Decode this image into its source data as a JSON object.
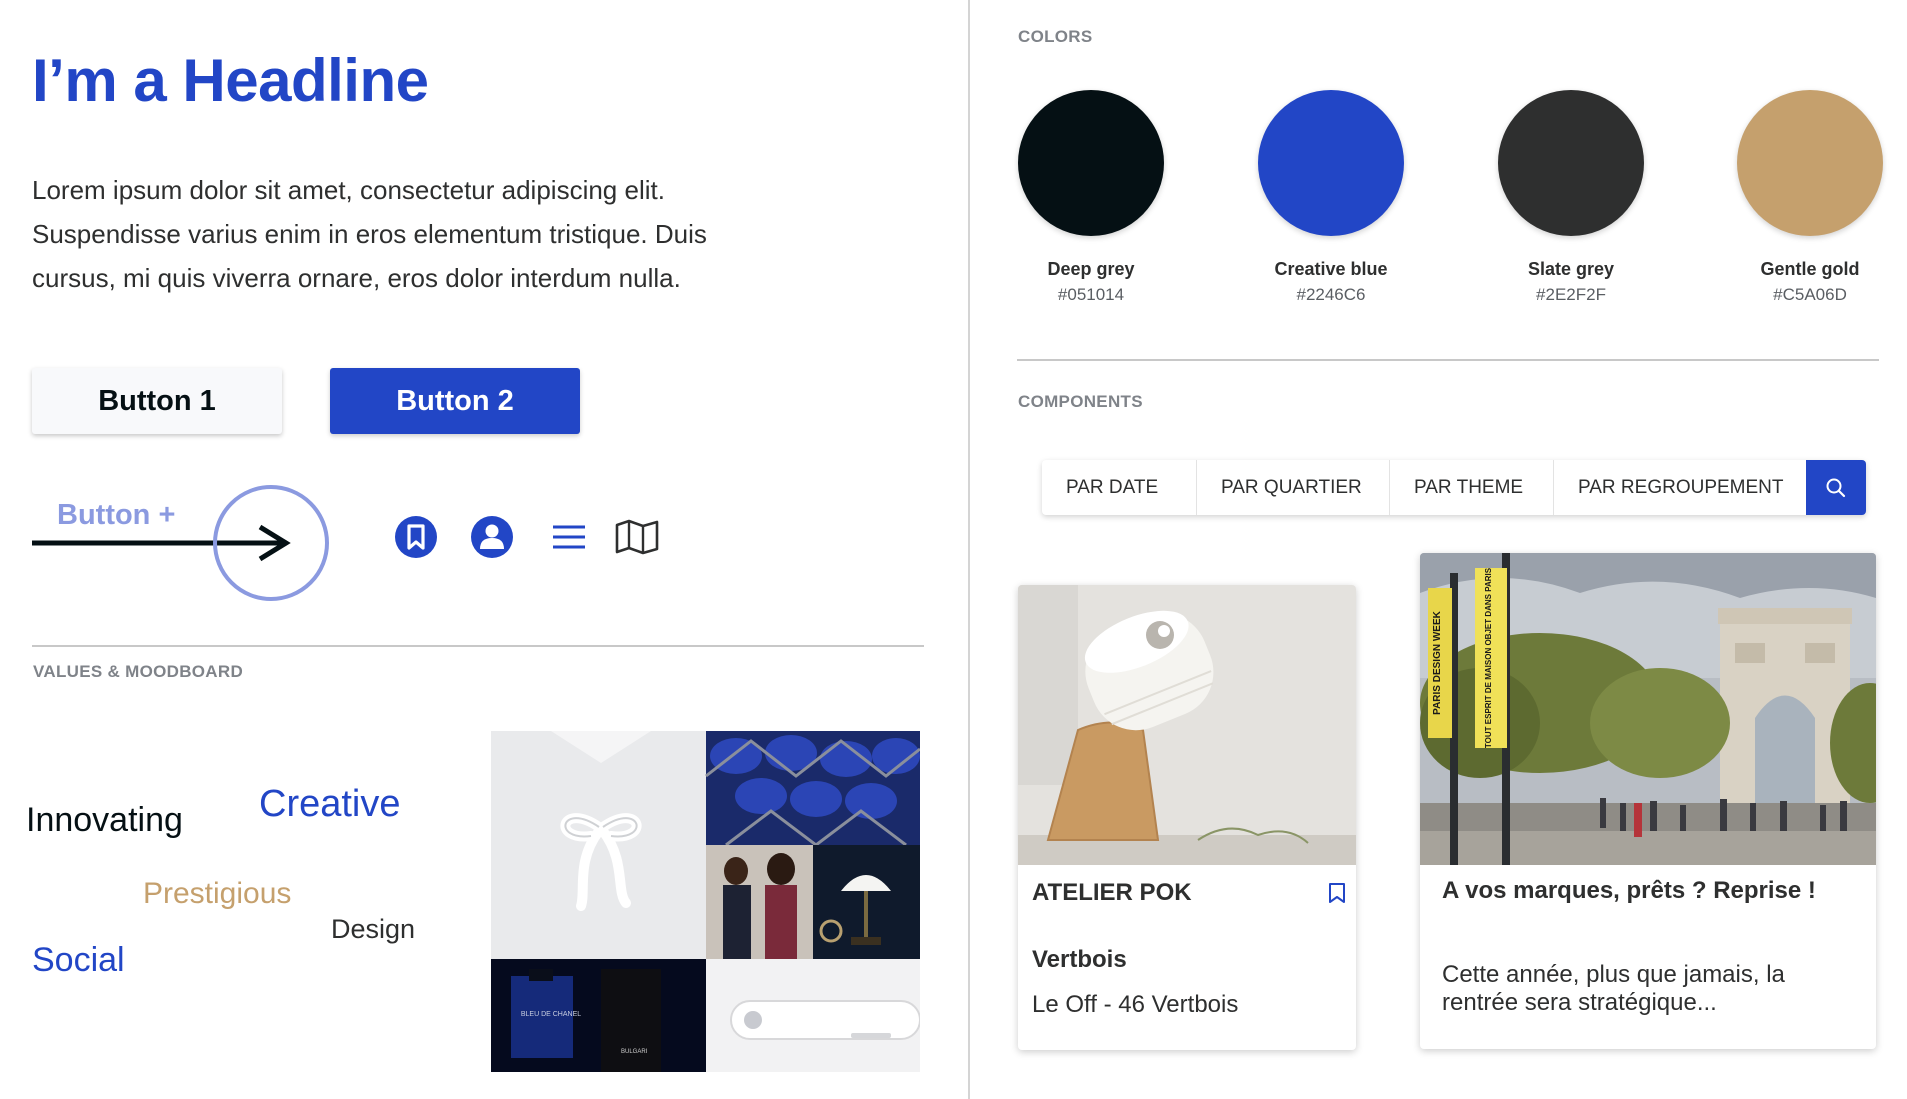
{
  "headline": "I’m a Headline",
  "body_lines": [
    "Lorem ipsum dolor sit amet, consectetur adipiscing elit.",
    "Suspendisse varius enim in eros elementum tristique. Duis",
    "cursus, mi quis viverra ornare, eros dolor interdum nulla."
  ],
  "buttons": {
    "button1": "Button 1",
    "button2": "Button 2",
    "button_plus": "Button  +"
  },
  "icons": [
    "bookmark-icon",
    "user-icon",
    "menu-icon",
    "map-icon"
  ],
  "values_section": {
    "label": "VALUES & MOODBOARD",
    "words": {
      "innovating": "Innovating",
      "creative": "Creative",
      "prestigious": "Prestigious",
      "design": "Design",
      "social": "Social"
    },
    "moodboard_text": {
      "bottle": "BLEU DE CHANEL",
      "bulgari": "BULGARI"
    }
  },
  "colors_section": {
    "label": "COLORS",
    "swatches": [
      {
        "name": "Deep grey",
        "hex": "#051014"
      },
      {
        "name": "Creative blue",
        "hex": "#2246C6"
      },
      {
        "name": "Slate grey",
        "hex": "#2E2F2F"
      },
      {
        "name": "Gentle gold",
        "hex": "#C5A06D"
      }
    ]
  },
  "components_section": {
    "label": "COMPONENTS",
    "filters": [
      "PAR DATE",
      "PAR QUARTIER",
      "PAR THEME",
      "PAR REGROUPEMENT"
    ]
  },
  "cards": [
    {
      "title": "ATELIER POK",
      "subtitle": "Vertbois",
      "text": "Le Off - 46 Vertbois"
    },
    {
      "title": "A vos marques, prêts ? Reprise !",
      "text_lines": [
        "Cette année, plus que jamais, la",
        "rentrée sera stratégique..."
      ],
      "banner_text_1": "PARIS DESIGN WEEK",
      "banner_text_2": "TOUT ESPRIT DE MAISON OBJET DANS PARIS"
    }
  ],
  "accent": "#2246C6",
  "gold": "#C5A06D"
}
